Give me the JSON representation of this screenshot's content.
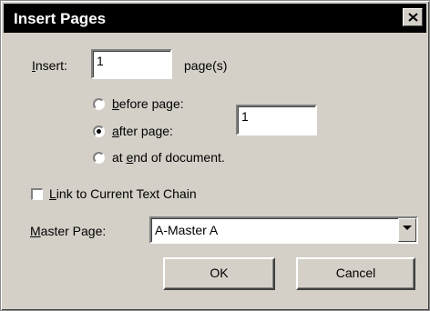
{
  "window": {
    "title": "Insert Pages"
  },
  "insert": {
    "label_prefix": "",
    "label_accel": "I",
    "label_rest": "nsert:",
    "value": "1",
    "unit": "page(s)"
  },
  "position": {
    "options": [
      {
        "accel": "b",
        "rest": "efore page:",
        "selected": false
      },
      {
        "accel": "a",
        "rest": "fter page:",
        "selected": true
      },
      {
        "pre": "at ",
        "accel": "e",
        "rest": "nd of document.",
        "selected": false
      }
    ],
    "page_value": "1"
  },
  "link_chain": {
    "accel": "L",
    "rest": "ink to Current Text Chain",
    "checked": false
  },
  "master_page": {
    "accel": "M",
    "rest": "aster Page:",
    "selected": "A-Master A"
  },
  "buttons": {
    "ok": "OK",
    "cancel": "Cancel"
  },
  "colors": {
    "dialog_face": "#d4d0c8",
    "titlebar": "#000000"
  }
}
